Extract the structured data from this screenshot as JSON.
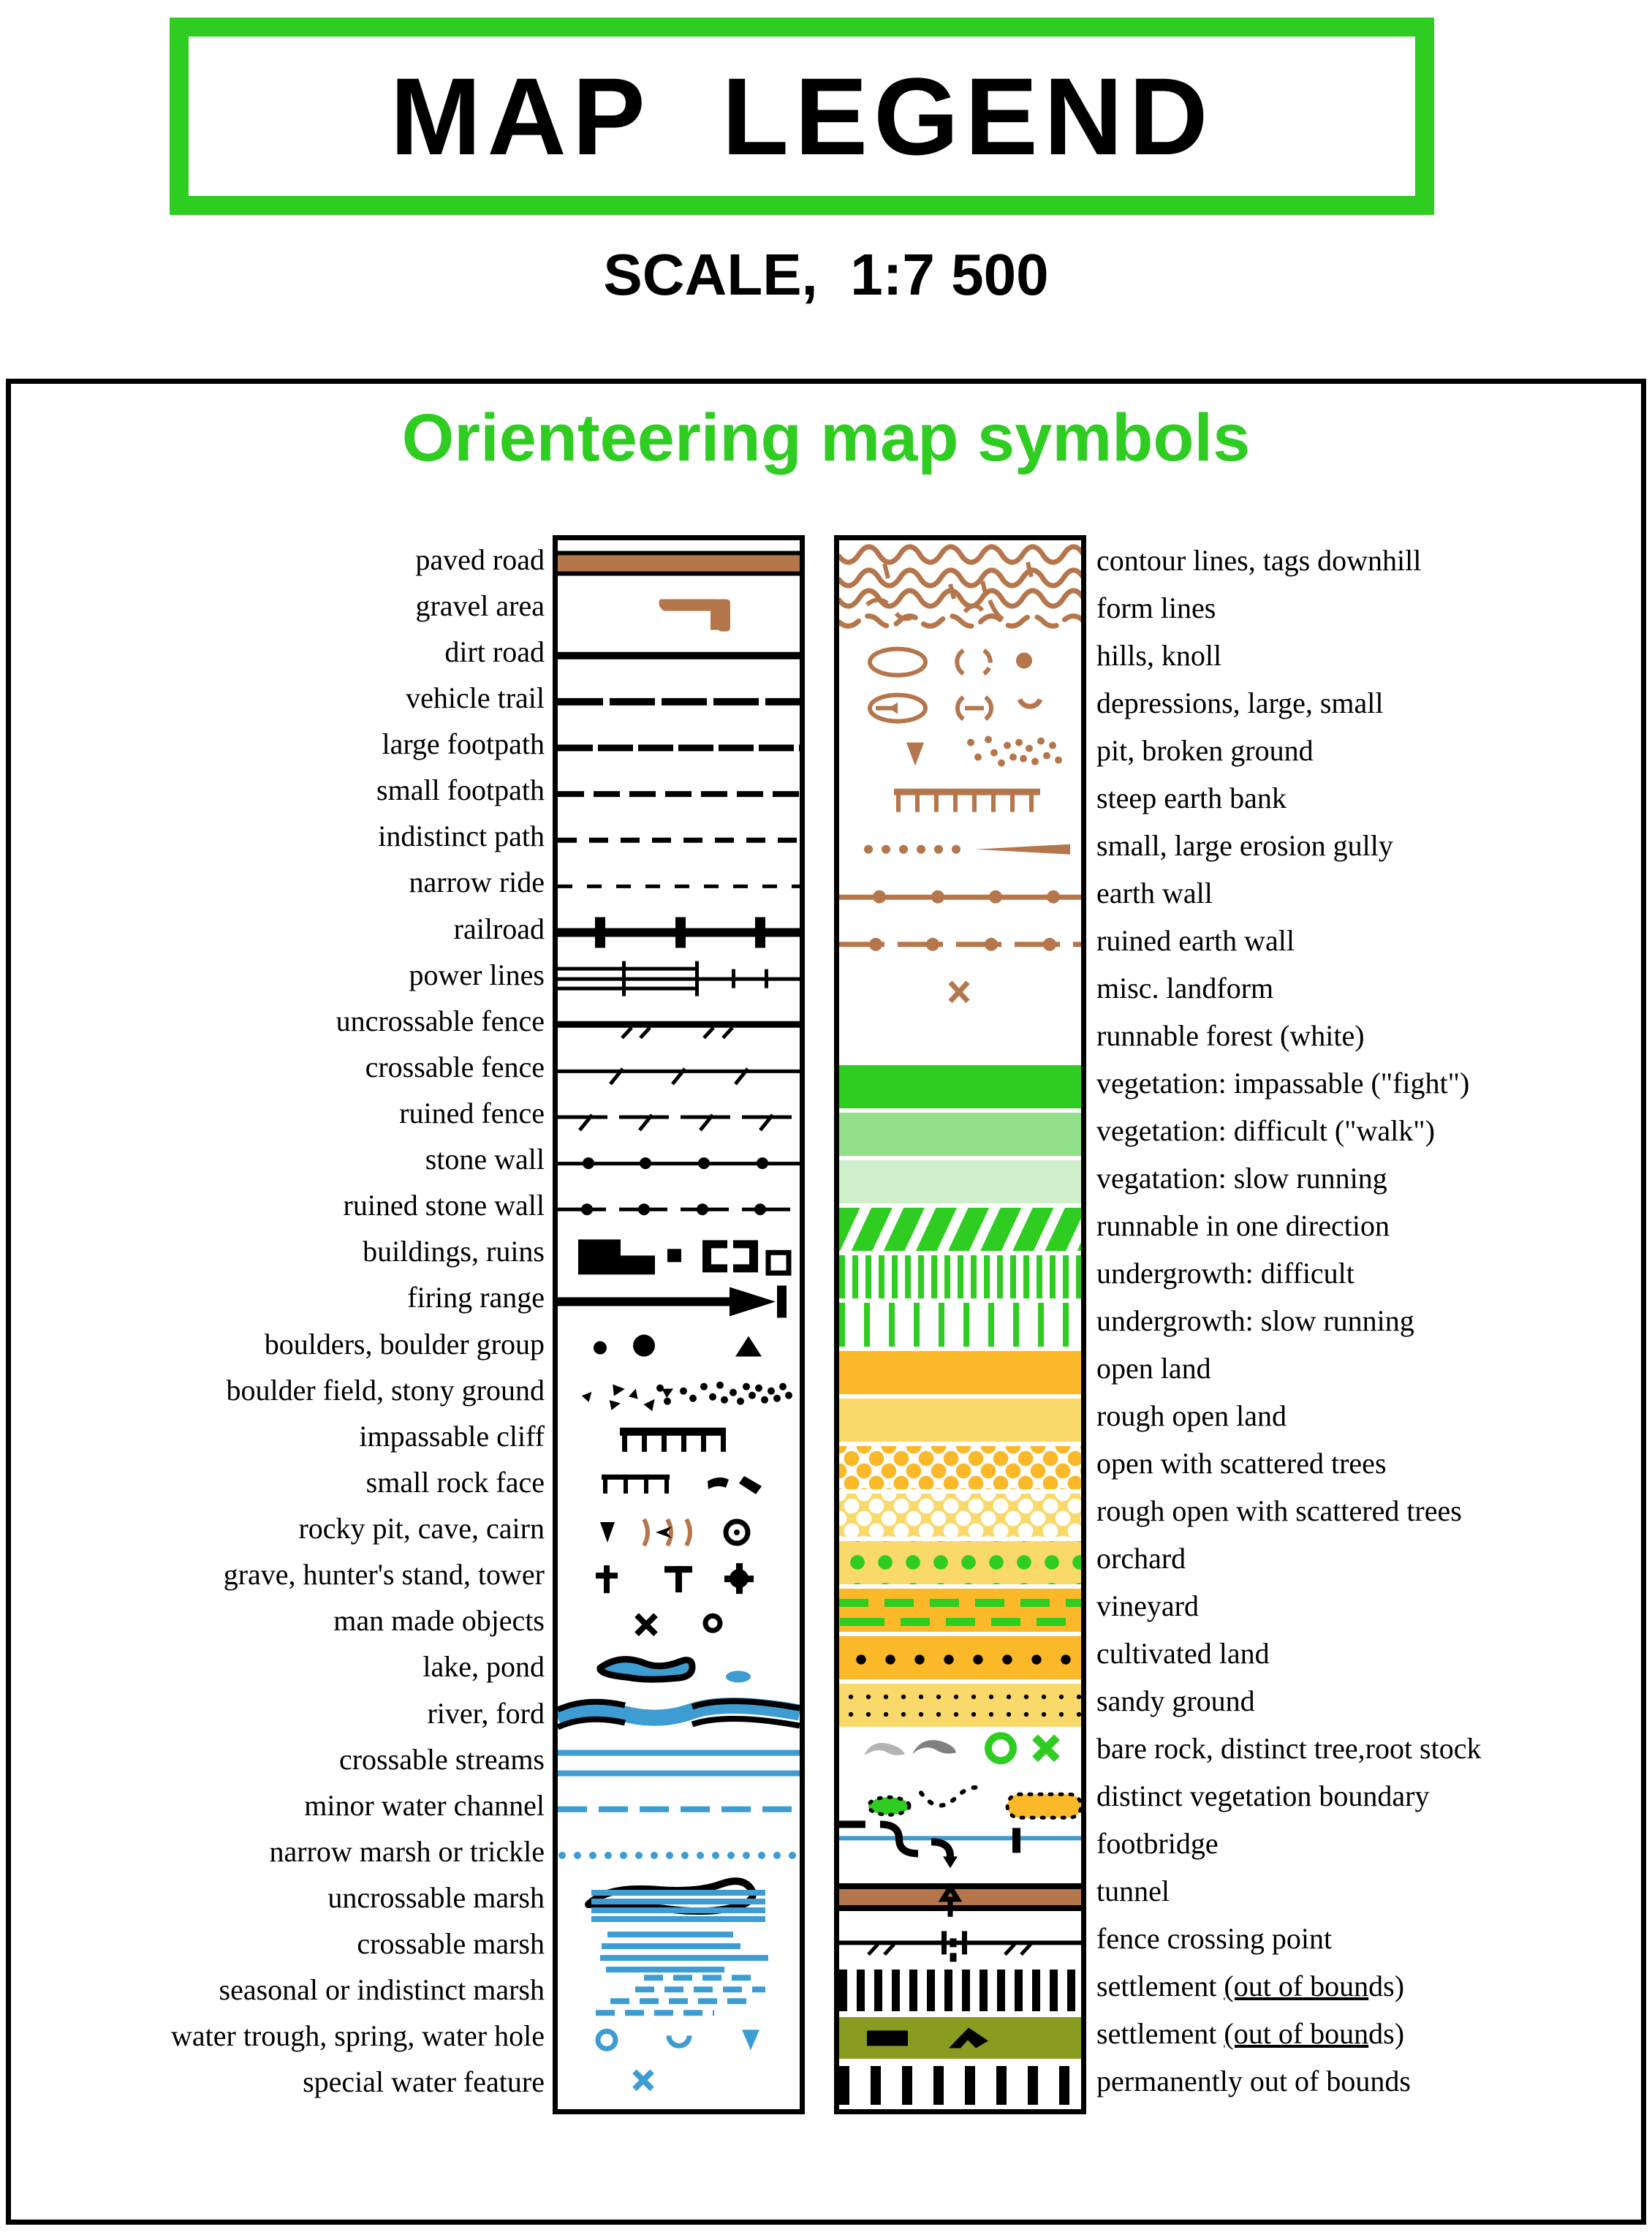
{
  "header": {
    "title": "MAP  LEGEND",
    "scale": "SCALE,  1:7 500"
  },
  "legend": {
    "subtitle": "Orienteering map symbols",
    "colors": {
      "accent_green": "#2fcc22",
      "brown": "#b5764c",
      "blue": "#3d9cd2",
      "yellow_dark": "#fbb829",
      "yellow_light": "#fad96b",
      "green_dark": "#2fcc22",
      "green_mid": "#93e08a",
      "green_light": "#cfeecb",
      "olive": "#8a9b22",
      "black": "#000000"
    },
    "left_column": [
      {
        "label": "paved road",
        "symbol": "paved-road-symbol"
      },
      {
        "label": "gravel area",
        "symbol": "gravel-area-symbol"
      },
      {
        "label": "dirt road",
        "symbol": "dirt-road-symbol"
      },
      {
        "label": "vehicle trail",
        "symbol": "vehicle-trail-symbol"
      },
      {
        "label": "large footpath",
        "symbol": "large-footpath-symbol"
      },
      {
        "label": "small footpath",
        "symbol": "small-footpath-symbol"
      },
      {
        "label": "indistinct path",
        "symbol": "indistinct-path-symbol"
      },
      {
        "label": "narrow ride",
        "symbol": "narrow-ride-symbol"
      },
      {
        "label": "railroad",
        "symbol": "railroad-symbol"
      },
      {
        "label": "power lines",
        "symbol": "power-lines-symbol"
      },
      {
        "label": "uncrossable fence",
        "symbol": "uncrossable-fence-symbol"
      },
      {
        "label": "crossable fence",
        "symbol": "crossable-fence-symbol"
      },
      {
        "label": "ruined fence",
        "symbol": "ruined-fence-symbol"
      },
      {
        "label": "stone wall",
        "symbol": "stone-wall-symbol"
      },
      {
        "label": "ruined stone wall",
        "symbol": "ruined-stone-wall-symbol"
      },
      {
        "label": "buildings, ruins",
        "symbol": "buildings-ruins-symbol"
      },
      {
        "label": "firing range",
        "symbol": "firing-range-symbol"
      },
      {
        "label": "boulders, boulder group",
        "symbol": "boulders-symbol"
      },
      {
        "label": "boulder field, stony ground",
        "symbol": "boulder-field-symbol"
      },
      {
        "label": "impassable cliff",
        "symbol": "impassable-cliff-symbol"
      },
      {
        "label": "small rock face",
        "symbol": "small-rock-face-symbol"
      },
      {
        "label": "rocky pit, cave, cairn",
        "symbol": "rocky-pit-cave-cairn-symbol"
      },
      {
        "label": "grave, hunter's stand, tower",
        "symbol": "grave-hunters-stand-tower-symbol"
      },
      {
        "label": "man made objects",
        "symbol": "man-made-objects-symbol"
      },
      {
        "label": "lake, pond",
        "symbol": "lake-pond-symbol"
      },
      {
        "label": "river, ford",
        "symbol": "river-ford-symbol"
      },
      {
        "label": "crossable streams",
        "symbol": "crossable-streams-symbol"
      },
      {
        "label": "minor water channel",
        "symbol": "minor-water-channel-symbol"
      },
      {
        "label": "narrow marsh or trickle",
        "symbol": "narrow-marsh-symbol"
      },
      {
        "label": "uncrossable marsh",
        "symbol": "uncrossable-marsh-symbol"
      },
      {
        "label": "crossable marsh",
        "symbol": "crossable-marsh-symbol"
      },
      {
        "label": "seasonal or indistinct marsh",
        "symbol": "seasonal-marsh-symbol"
      },
      {
        "label": "water trough, spring, water hole",
        "symbol": "water-trough-spring-symbol"
      },
      {
        "label": "special water feature",
        "symbol": "special-water-feature-symbol"
      }
    ],
    "right_column": [
      {
        "label": "contour lines, tags downhill",
        "symbol": "contour-lines-symbol"
      },
      {
        "label": "form lines",
        "symbol": "form-lines-symbol"
      },
      {
        "label": "hills, knoll",
        "symbol": "hills-knoll-symbol"
      },
      {
        "label": "depressions, large, small",
        "symbol": "depressions-symbol"
      },
      {
        "label": "pit, broken ground",
        "symbol": "pit-broken-ground-symbol"
      },
      {
        "label": "steep earth bank",
        "symbol": "steep-earth-bank-symbol"
      },
      {
        "label": "small, large erosion gully",
        "symbol": "erosion-gully-symbol"
      },
      {
        "label": "earth wall",
        "symbol": "earth-wall-symbol"
      },
      {
        "label": "ruined earth wall",
        "symbol": "ruined-earth-wall-symbol"
      },
      {
        "label": "misc. landform",
        "symbol": "misc-landform-symbol"
      },
      {
        "label": "runnable forest (white)",
        "symbol": "runnable-forest-symbol"
      },
      {
        "label": "vegetation: impassable (\"fight\")",
        "symbol": "vegetation-impassable-symbol"
      },
      {
        "label": "vegetation: difficult (\"walk\")",
        "symbol": "vegetation-difficult-symbol"
      },
      {
        "label": "vegatation: slow running",
        "symbol": "vegetation-slow-running-symbol"
      },
      {
        "label": "runnable in one direction",
        "symbol": "runnable-one-direction-symbol"
      },
      {
        "label": "undergrowth: difficult",
        "symbol": "undergrowth-difficult-symbol"
      },
      {
        "label": "undergrowth: slow running",
        "symbol": "undergrowth-slow-symbol"
      },
      {
        "label": "open land",
        "symbol": "open-land-symbol"
      },
      {
        "label": "rough open land",
        "symbol": "rough-open-land-symbol"
      },
      {
        "label": "open with scattered trees",
        "symbol": "open-scattered-trees-symbol"
      },
      {
        "label": "rough open with scattered trees",
        "symbol": "rough-open-scattered-trees-symbol"
      },
      {
        "label": "orchard",
        "symbol": "orchard-symbol"
      },
      {
        "label": "vineyard",
        "symbol": "vineyard-symbol"
      },
      {
        "label": "cultivated land",
        "symbol": "cultivated-land-symbol"
      },
      {
        "label": "sandy ground",
        "symbol": "sandy-ground-symbol"
      },
      {
        "label": "bare rock, distinct tree,root stock",
        "symbol": "bare-rock-distinct-tree-symbol"
      },
      {
        "label": "distinct vegetation boundary",
        "symbol": "distinct-vegetation-boundary-symbol"
      },
      {
        "label": "footbridge",
        "symbol": "footbridge-symbol"
      },
      {
        "label": "tunnel",
        "symbol": "tunnel-symbol"
      },
      {
        "label": "fence crossing point",
        "symbol": "fence-crossing-point-symbol"
      },
      {
        "label": "settlement (out of bounds)",
        "symbol": "settlement-out-of-bounds-1-symbol"
      },
      {
        "label": "settlement (out of bounds)",
        "symbol": "settlement-out-of-bounds-2-symbol"
      },
      {
        "label": "permanently out of bounds",
        "symbol": "permanently-out-of-bounds-symbol"
      }
    ]
  }
}
